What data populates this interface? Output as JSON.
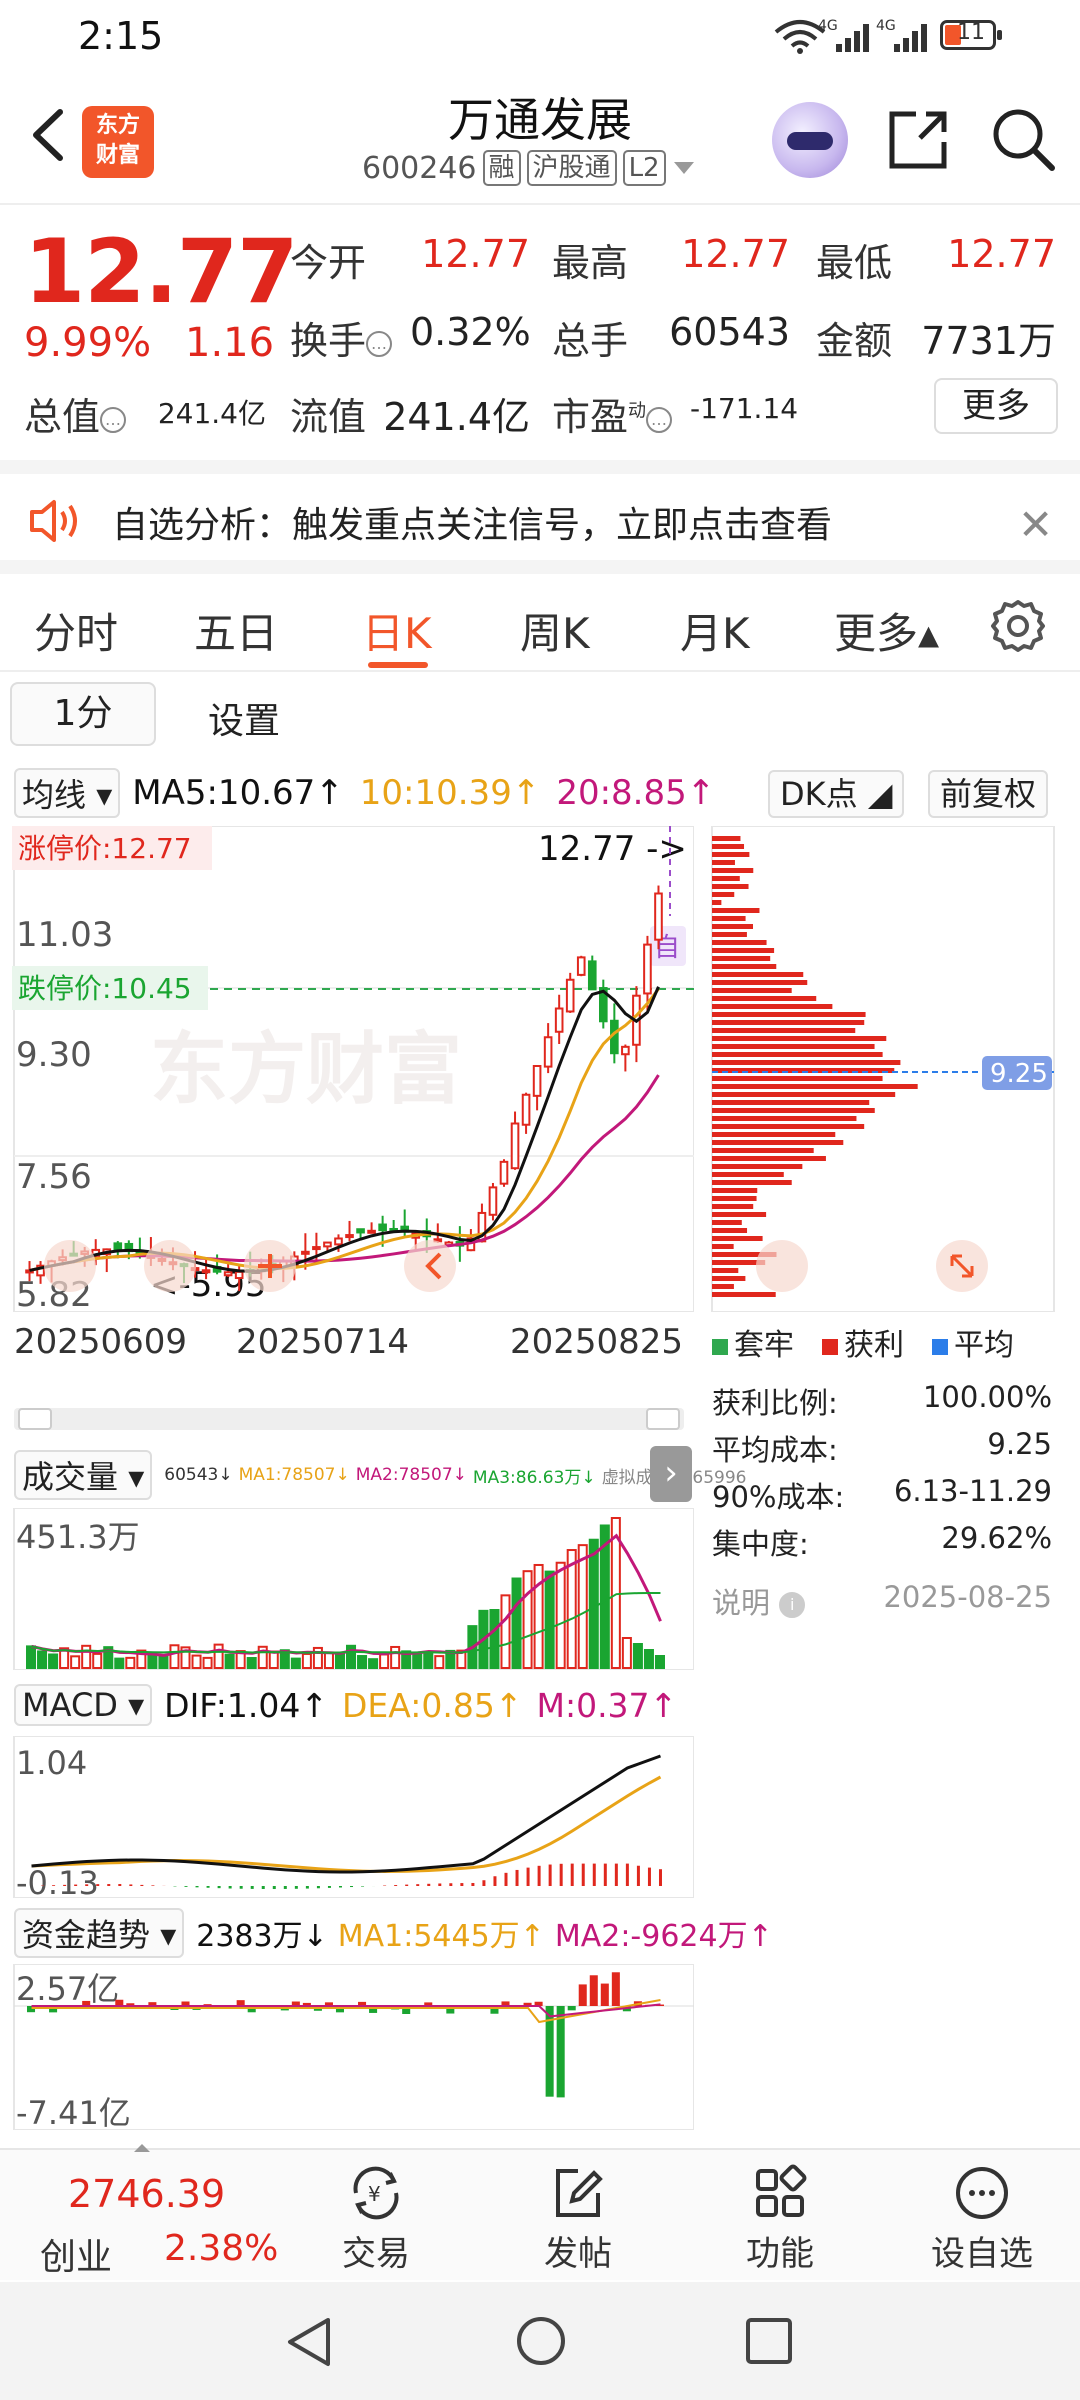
{
  "status_bar": {
    "time": "2:15",
    "battery": "11",
    "signal_labels": [
      "4G",
      "4G"
    ]
  },
  "header": {
    "stock_name": "万通发展",
    "stock_code": "600246",
    "tags": [
      "融",
      "沪股通",
      "L2"
    ],
    "logo_text": [
      "东方",
      "财富"
    ]
  },
  "quote": {
    "price": "12.77",
    "change_pct": "9.99%",
    "change": "1.16",
    "open_label": "今开",
    "open": "12.77",
    "high_label": "最高",
    "high": "12.77",
    "low_label": "最低",
    "low": "12.77",
    "turnover_label": "换手",
    "turnover": "0.32%",
    "volume_label": "总手",
    "volume": "60543",
    "amount_label": "金额",
    "amount": "7731万",
    "mktcap_label": "总值",
    "mktcap": "241.4亿",
    "float_label": "流值",
    "float_cap": "241.4亿",
    "pe_label": "市盈",
    "pe_superscript": "动",
    "pe": "-171.14",
    "more": "更多"
  },
  "alert": {
    "text": "自选分析：触发重点关注信号，立即点击查看"
  },
  "tabs": [
    {
      "label": "分时"
    },
    {
      "label": "五日"
    },
    {
      "label": "日K"
    },
    {
      "label": "周K"
    },
    {
      "label": "月K"
    },
    {
      "label": "更多▴"
    }
  ],
  "subbar": {
    "period": "1分",
    "settings": "设置"
  },
  "ma": {
    "selector": "均线",
    "ma5": "MA5:10.67↑",
    "ma10": "10:10.39↑",
    "ma20": "20:8.85↑",
    "dk": "DK点",
    "fq": "前复权",
    "colors": {
      "ma5": "#111111",
      "ma10": "#e8a317",
      "ma20": "#c2187a"
    }
  },
  "kline": {
    "y_ticks": [
      "11.03",
      "9.30",
      "7.56",
      "5.82"
    ],
    "limit_up": "涨停价:12.77",
    "limit_down": "跌停价:10.45",
    "last_price_tag": "12.77",
    "low_mark": "5.95",
    "self_tag": "自",
    "x_ticks": [
      "20250609",
      "20250714",
      "20250825"
    ],
    "watermark": "东方财富"
  },
  "chips": {
    "price_tag": "9.25",
    "legend": [
      {
        "label": "套牢",
        "color": "#2fa84f"
      },
      {
        "label": "获利",
        "color": "#e0271d"
      },
      {
        "label": "平均",
        "color": "#2b7de9"
      }
    ],
    "stats": [
      {
        "label": "获利比例:",
        "value": "100.00%"
      },
      {
        "label": "平均成本:",
        "value": "9.25"
      },
      {
        "label": "90%成本:",
        "value": "6.13-11.29"
      },
      {
        "label": "集中度:",
        "value": "29.62%"
      }
    ],
    "note_label": "说明",
    "date": "2025-08-25"
  },
  "volume_panel": {
    "selector": "成交量",
    "legend": [
      "60543↓",
      "MA1:78507↓",
      "MA2:78507↓",
      "MA3:86.63万↓",
      "虚拟成交量:65996"
    ],
    "y_tick": "451.3万"
  },
  "macd_panel": {
    "selector": "MACD",
    "dif": "DIF:1.04↑",
    "dea": "DEA:0.85↑",
    "m": "M:0.37↑",
    "y_ticks": [
      "1.04",
      "-0.13"
    ]
  },
  "fund_panel": {
    "selector": "资金趋势",
    "value": "2383万↓",
    "ma1": "MA1:5445万↑",
    "ma2": "MA2:-9624万↑",
    "y_ticks": [
      "2.57亿",
      "-7.41亿"
    ]
  },
  "bottom_nav": {
    "index_value": "2746.39",
    "index_name": "创业",
    "index_pct": "2.38%",
    "items": [
      {
        "label": "交易"
      },
      {
        "label": "发帖"
      },
      {
        "label": "功能"
      },
      {
        "label": "设自选"
      }
    ]
  }
}
